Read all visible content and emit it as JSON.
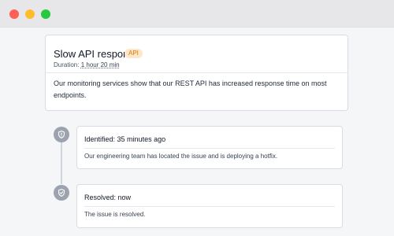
{
  "incident": {
    "title": "Slow API response",
    "badge": "API",
    "duration_label": "Duration:",
    "duration_value": "1 hour 20 min",
    "description": "Our monitoring services show that our REST API has increased response time on most endpoints."
  },
  "updates": [
    {
      "status": "Identified:",
      "time": "35 minutes ago",
      "message": "Our engineering team has located the issue and is deploying a hotfix.",
      "icon": "shield-icon"
    },
    {
      "status": "Resolved:",
      "time": "now",
      "message": "The issue is resolved.",
      "icon": "shield-check-icon"
    }
  ],
  "colors": {
    "badge_bg": "#fde7c9",
    "badge_text": "#d97706",
    "status_icon": "#9ca3af"
  }
}
